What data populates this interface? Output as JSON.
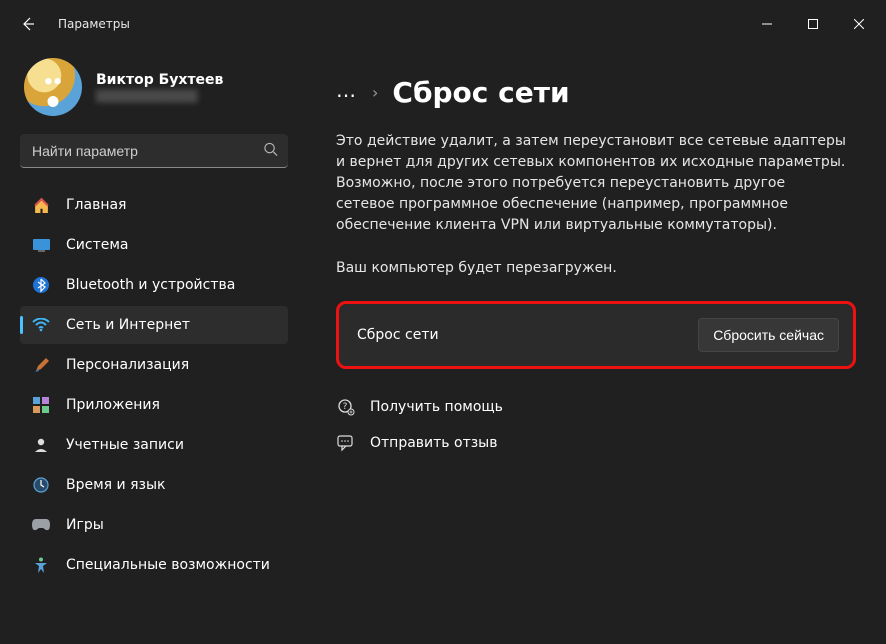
{
  "window": {
    "title": "Параметры"
  },
  "user": {
    "name": "Виктор Бухтеев",
    "email": "████████████"
  },
  "search": {
    "placeholder": "Найти параметр"
  },
  "sidebar": {
    "items": [
      {
        "icon": "home",
        "label": "Главная"
      },
      {
        "icon": "system",
        "label": "Система"
      },
      {
        "icon": "bluetooth",
        "label": "Bluetooth и устройства"
      },
      {
        "icon": "wifi",
        "label": "Сеть и Интернет",
        "selected": true
      },
      {
        "icon": "brush",
        "label": "Персонализация"
      },
      {
        "icon": "apps",
        "label": "Приложения"
      },
      {
        "icon": "account",
        "label": "Учетные записи"
      },
      {
        "icon": "time",
        "label": "Время и язык"
      },
      {
        "icon": "gaming",
        "label": "Игры"
      },
      {
        "icon": "accessibility",
        "label": "Специальные возможности"
      }
    ]
  },
  "breadcrumb": {
    "ellipsis": "…",
    "chevron": "›",
    "title": "Сброс сети"
  },
  "content": {
    "description": "Это действие удалит, а затем переустановит все сетевые адаптеры и вернет для других сетевых компонентов их исходные параметры. Возможно, после этого потребуется переустановить другое сетевое программное обеспечение (например, программное обеспечение клиента VPN или виртуальные коммутаторы).",
    "restart_note": "Ваш компьютер будет перезагружен.",
    "reset_row": {
      "label": "Сброс сети",
      "button": "Сбросить сейчас"
    },
    "links": {
      "help": "Получить помощь",
      "feedback": "Отправить отзыв"
    }
  }
}
